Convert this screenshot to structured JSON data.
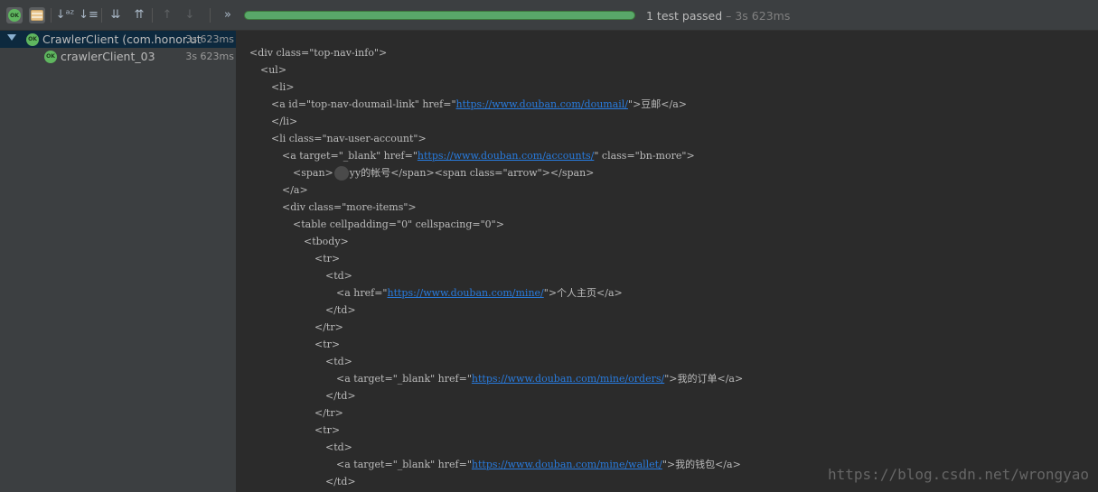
{
  "toolbar": {
    "buttons": [
      {
        "id": "show-passed",
        "icon": "ok-badge-icon",
        "glyph": "OK",
        "toggled": true
      },
      {
        "id": "show-ignored",
        "icon": "stack-icon",
        "glyph": "",
        "toggled": true
      },
      {
        "id": "sort-alpha",
        "icon": "sort-alphabetically-icon",
        "glyph": "↓ᵃᶻ"
      },
      {
        "id": "sort-duration",
        "icon": "sort-by-duration-icon",
        "glyph": "↓≡"
      },
      {
        "id": "expand-all",
        "icon": "expand-all-icon",
        "glyph": "⇊"
      },
      {
        "id": "collapse-all",
        "icon": "collapse-all-icon",
        "glyph": "⇈"
      },
      {
        "id": "prev-failed",
        "icon": "arrow-up-icon",
        "glyph": "↑"
      },
      {
        "id": "next-failed",
        "icon": "arrow-down-icon",
        "glyph": "↓"
      },
      {
        "id": "more",
        "icon": "double-chevron-right-icon",
        "glyph": "»"
      }
    ],
    "progress_fraction": 1.0,
    "status_passed": "1 test passed",
    "status_time": " – 3s 623ms"
  },
  "tree": {
    "root": {
      "badge": "OK",
      "label": "CrawlerClient (com.honor.ut",
      "duration": "3s 623ms"
    },
    "child": {
      "badge": "OK",
      "label": "crawlerClient_03",
      "duration": "3s 623ms"
    }
  },
  "console": {
    "lines": [
      {
        "indent": 0,
        "parts": [
          {
            "t": "<div class=\"top-nav-info\">"
          }
        ]
      },
      {
        "indent": 1,
        "parts": [
          {
            "t": "<ul>"
          }
        ]
      },
      {
        "indent": 2,
        "parts": [
          {
            "t": "<li>"
          }
        ]
      },
      {
        "indent": 2,
        "parts": [
          {
            "t": "<a id=\"top-nav-doumail-link\" href=\""
          },
          {
            "t": "https://www.douban.com/doumail/",
            "link": true
          },
          {
            "t": "\">豆邮</a>"
          }
        ]
      },
      {
        "indent": 2,
        "parts": [
          {
            "t": "</li>"
          }
        ]
      },
      {
        "indent": 2,
        "parts": [
          {
            "t": "<li class=\"nav-user-account\">"
          }
        ]
      },
      {
        "indent": 3,
        "parts": [
          {
            "t": "<a target=\"_blank\" href=\""
          },
          {
            "t": "https://www.douban.com/accounts/",
            "link": true
          },
          {
            "t": "\" class=\"bn-more\">"
          }
        ]
      },
      {
        "indent": 4,
        "parts": [
          {
            "t": "<span>"
          },
          {
            "blur": true
          },
          {
            "t": "yy的帐号</span><span class=\"arrow\"></span>"
          }
        ]
      },
      {
        "indent": 3,
        "parts": [
          {
            "t": "</a>"
          }
        ]
      },
      {
        "indent": 3,
        "parts": [
          {
            "t": "<div class=\"more-items\">"
          }
        ]
      },
      {
        "indent": 4,
        "parts": [
          {
            "t": "<table cellpadding=\"0\" cellspacing=\"0\">"
          }
        ]
      },
      {
        "indent": 5,
        "parts": [
          {
            "t": "<tbody>"
          }
        ]
      },
      {
        "indent": 6,
        "parts": [
          {
            "t": "<tr>"
          }
        ]
      },
      {
        "indent": 7,
        "parts": [
          {
            "t": "<td>"
          }
        ]
      },
      {
        "indent": 8,
        "parts": [
          {
            "t": "<a href=\""
          },
          {
            "t": "https://www.douban.com/mine/",
            "link": true
          },
          {
            "t": "\">个人主页</a>"
          }
        ]
      },
      {
        "indent": 7,
        "parts": [
          {
            "t": "</td>"
          }
        ]
      },
      {
        "indent": 6,
        "parts": [
          {
            "t": "</tr>"
          }
        ]
      },
      {
        "indent": 6,
        "parts": [
          {
            "t": "<tr>"
          }
        ]
      },
      {
        "indent": 7,
        "parts": [
          {
            "t": "<td>"
          }
        ]
      },
      {
        "indent": 8,
        "parts": [
          {
            "t": "<a target=\"_blank\" href=\""
          },
          {
            "t": "https://www.douban.com/mine/orders/",
            "link": true
          },
          {
            "t": "\">我的订单</a>"
          }
        ]
      },
      {
        "indent": 7,
        "parts": [
          {
            "t": "</td>"
          }
        ]
      },
      {
        "indent": 6,
        "parts": [
          {
            "t": "</tr>"
          }
        ]
      },
      {
        "indent": 6,
        "parts": [
          {
            "t": "<tr>"
          }
        ]
      },
      {
        "indent": 7,
        "parts": [
          {
            "t": "<td>"
          }
        ]
      },
      {
        "indent": 8,
        "parts": [
          {
            "t": "<a target=\"_blank\" href=\""
          },
          {
            "t": "https://www.douban.com/mine/wallet/",
            "link": true
          },
          {
            "t": "\">我的钱包</a>"
          }
        ]
      },
      {
        "indent": 7,
        "parts": [
          {
            "t": "</td>"
          }
        ]
      }
    ]
  },
  "watermark": "https://blog.csdn.net/wrongyao",
  "colors": {
    "accent_green": "#59a869",
    "link": "#287bde",
    "selection": "#0d293e"
  }
}
